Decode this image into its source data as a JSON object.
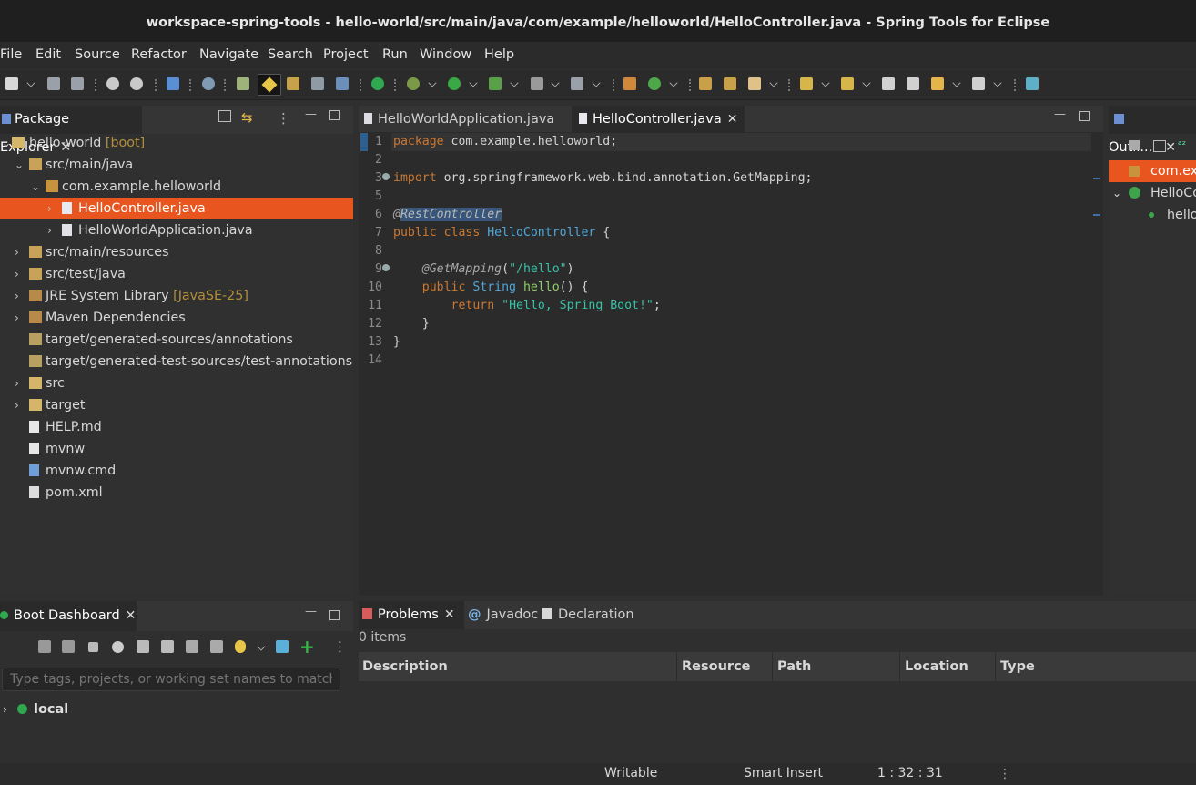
{
  "window": {
    "title": "workspace-spring-tools - hello-world/src/main/java/com/example/helloworld/HelloController.java - Spring Tools for Eclipse"
  },
  "menu": [
    "File",
    "Edit",
    "Source",
    "Refactor",
    "Navigate",
    "Search",
    "Project",
    "Run",
    "Window",
    "Help"
  ],
  "package_explorer": {
    "title": "Package Explorer",
    "items": [
      {
        "label": "hello-world",
        "deco": " [boot]"
      },
      {
        "label": "src/main/java",
        "deco": ""
      },
      {
        "label": "com.example.helloworld",
        "deco": ""
      },
      {
        "label": "HelloController.java",
        "deco": ""
      },
      {
        "label": "HelloWorldApplication.java",
        "deco": ""
      },
      {
        "label": "src/main/resources",
        "deco": ""
      },
      {
        "label": "src/test/java",
        "deco": ""
      },
      {
        "label": "JRE System Library",
        "deco": " [JavaSE-25]"
      },
      {
        "label": "Maven Dependencies",
        "deco": ""
      },
      {
        "label": "target/generated-sources/annotations",
        "deco": ""
      },
      {
        "label": "target/generated-test-sources/test-annotations",
        "deco": ""
      },
      {
        "label": "src",
        "deco": ""
      },
      {
        "label": "target",
        "deco": ""
      },
      {
        "label": "HELP.md",
        "deco": ""
      },
      {
        "label": "mvnw",
        "deco": ""
      },
      {
        "label": "mvnw.cmd",
        "deco": ""
      },
      {
        "label": "pom.xml",
        "deco": ""
      }
    ]
  },
  "editor": {
    "tabs": [
      "HelloWorldApplication.java",
      "HelloController.java"
    ],
    "lines": [
      {
        "n": "1",
        "t": [
          {
            "c": "kw",
            "v": "package"
          },
          {
            "c": "",
            "v": " com.example.helloworld;"
          }
        ]
      },
      {
        "n": "2",
        "t": []
      },
      {
        "n": "3",
        "t": [
          {
            "c": "kw",
            "v": "import"
          },
          {
            "c": "",
            "v": " org.springframework.web.bind.annotation.GetMapping;"
          }
        ]
      },
      {
        "n": "5",
        "t": []
      },
      {
        "n": "6",
        "t": [
          {
            "c": "ann",
            "v": "@"
          },
          {
            "c": "annhl",
            "v": "RestController"
          }
        ]
      },
      {
        "n": "7",
        "t": [
          {
            "c": "kw",
            "v": "public class"
          },
          {
            "c": "",
            "v": " "
          },
          {
            "c": "ty",
            "v": "HelloController"
          },
          {
            "c": "",
            "v": " {"
          }
        ]
      },
      {
        "n": "8",
        "t": []
      },
      {
        "n": "9",
        "t": [
          {
            "c": "",
            "v": "    "
          },
          {
            "c": "ann",
            "v": "@GetMapping"
          },
          {
            "c": "",
            "v": "("
          },
          {
            "c": "str",
            "v": "\"/hello\""
          },
          {
            "c": "",
            "v": ")"
          }
        ]
      },
      {
        "n": "10",
        "t": [
          {
            "c": "",
            "v": "    "
          },
          {
            "c": "kw",
            "v": "public"
          },
          {
            "c": "",
            "v": " "
          },
          {
            "c": "ty",
            "v": "String"
          },
          {
            "c": "",
            "v": " "
          },
          {
            "c": "fn",
            "v": "hello"
          },
          {
            "c": "",
            "v": "() {"
          }
        ]
      },
      {
        "n": "11",
        "t": [
          {
            "c": "",
            "v": "        "
          },
          {
            "c": "kw",
            "v": "return"
          },
          {
            "c": "",
            "v": " "
          },
          {
            "c": "str",
            "v": "\"Hello, Spring Boot!\""
          },
          {
            "c": "",
            "v": ";"
          }
        ]
      },
      {
        "n": "12",
        "t": [
          {
            "c": "",
            "v": "    }"
          }
        ]
      },
      {
        "n": "13",
        "t": [
          {
            "c": "",
            "v": "}"
          }
        ]
      },
      {
        "n": "14",
        "t": []
      }
    ]
  },
  "outline": {
    "title": "Outli...",
    "items": [
      "com.exa",
      "HelloCo",
      "hello"
    ]
  },
  "boot_dashboard": {
    "title": "Boot Dashboard",
    "filter_placeholder": "Type tags, projects, or working set names to match (i...",
    "items": [
      "local"
    ]
  },
  "bottom": {
    "tabs": [
      "Problems",
      "Javadoc",
      "Declaration"
    ],
    "count": "0 items",
    "columns": [
      "Description",
      "Resource",
      "Path",
      "Location",
      "Type"
    ]
  },
  "status": {
    "mode": "Writable",
    "insert": "Smart Insert",
    "position": "1 : 32 : 31"
  }
}
